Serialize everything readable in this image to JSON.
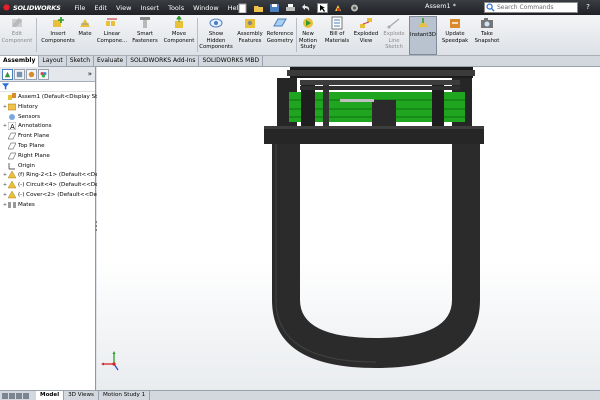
{
  "app": {
    "brand": "SOLIDWORKS",
    "document_title": "Assem1 *",
    "menu": [
      "File",
      "Edit",
      "View",
      "Insert",
      "Tools",
      "Window",
      "Help"
    ],
    "search_placeholder": "Search Commands",
    "help_glyph": "?"
  },
  "quick_access": [
    "new-icon",
    "open-icon",
    "save-icon",
    "print-icon",
    "undo-icon",
    "select-icon",
    "rebuild-icon",
    "options-icon"
  ],
  "commands": [
    {
      "name": "edit-component",
      "label": "Edit\nComponent",
      "dim": true
    },
    {
      "name": "insert-components",
      "label": "Insert\nComponents",
      "dim": false
    },
    {
      "name": "mate",
      "label": "Mate",
      "dim": false
    },
    {
      "name": "linear-component",
      "label": "Linear\nCompone...",
      "dim": false
    },
    {
      "name": "smart-fasteners",
      "label": "Smart\nFasteners",
      "dim": false
    },
    {
      "name": "move-component",
      "label": "Move\nComponent",
      "dim": false
    },
    {
      "name": "show-hidden",
      "label": "Show\nHidden\nComponents",
      "dim": false
    },
    {
      "name": "assembly-features",
      "label": "Assembly\nFeatures",
      "dim": false
    },
    {
      "name": "reference-geometry",
      "label": "Reference\nGeometry",
      "dim": false
    },
    {
      "name": "new-motion-study",
      "label": "New\nMotion\nStudy",
      "dim": false
    },
    {
      "name": "bill-of-materials",
      "label": "Bill of\nMaterials",
      "dim": false
    },
    {
      "name": "exploded-view",
      "label": "Exploded\nView",
      "dim": false
    },
    {
      "name": "explode-line-sketch",
      "label": "Explode\nLine\nSketch",
      "dim": true
    },
    {
      "name": "instant3d",
      "label": "Instant3D",
      "dim": false,
      "active": true
    },
    {
      "name": "update-speedpak",
      "label": "Update\nSpeedpak",
      "dim": false
    },
    {
      "name": "take-snapshot",
      "label": "Take\nSnapshot",
      "dim": false
    }
  ],
  "tabs": [
    {
      "label": "Assembly",
      "active": true
    },
    {
      "label": "Layout",
      "active": false
    },
    {
      "label": "Sketch",
      "active": false
    },
    {
      "label": "Evaluate",
      "active": false
    },
    {
      "label": "SOLIDWORKS Add-Ins",
      "active": false
    },
    {
      "label": "SOLIDWORKS MBD",
      "active": false
    }
  ],
  "tree": [
    {
      "label": "Assem1  (Default<Display State",
      "icon": "assembly-icon",
      "indent": 0,
      "expander": ""
    },
    {
      "label": "History",
      "icon": "history-icon",
      "indent": 1,
      "expander": "+"
    },
    {
      "label": "Sensors",
      "icon": "sensors-icon",
      "indent": 1,
      "expander": ""
    },
    {
      "label": "Annotations",
      "icon": "annotations-icon",
      "indent": 1,
      "expander": "+"
    },
    {
      "label": "Front Plane",
      "icon": "plane-icon",
      "indent": 1,
      "expander": ""
    },
    {
      "label": "Top Plane",
      "icon": "plane-icon",
      "indent": 1,
      "expander": ""
    },
    {
      "label": "Right Plane",
      "icon": "plane-icon",
      "indent": 1,
      "expander": ""
    },
    {
      "label": "Origin",
      "icon": "origin-icon",
      "indent": 1,
      "expander": ""
    },
    {
      "label": "(f) Ring-2<1> (Default<<De",
      "icon": "part-icon",
      "indent": 1,
      "expander": "+"
    },
    {
      "label": "(-) Circuit<4> (Default<<De",
      "icon": "part-icon",
      "indent": 1,
      "expander": "+"
    },
    {
      "label": "(-) Cover<2> (Default<<De",
      "icon": "part-icon",
      "indent": 1,
      "expander": "+"
    },
    {
      "label": "Mates",
      "icon": "mates-icon",
      "indent": 1,
      "expander": "+"
    }
  ],
  "bottom_tabs": [
    {
      "label": "Model",
      "active": true
    },
    {
      "label": "3D Views",
      "active": false
    },
    {
      "label": "Motion Study 1",
      "active": false
    }
  ],
  "colors": {
    "accent_red": "#e8202a",
    "pcb_green": "#1fa51f",
    "model_dark": "#2b2b2b"
  }
}
